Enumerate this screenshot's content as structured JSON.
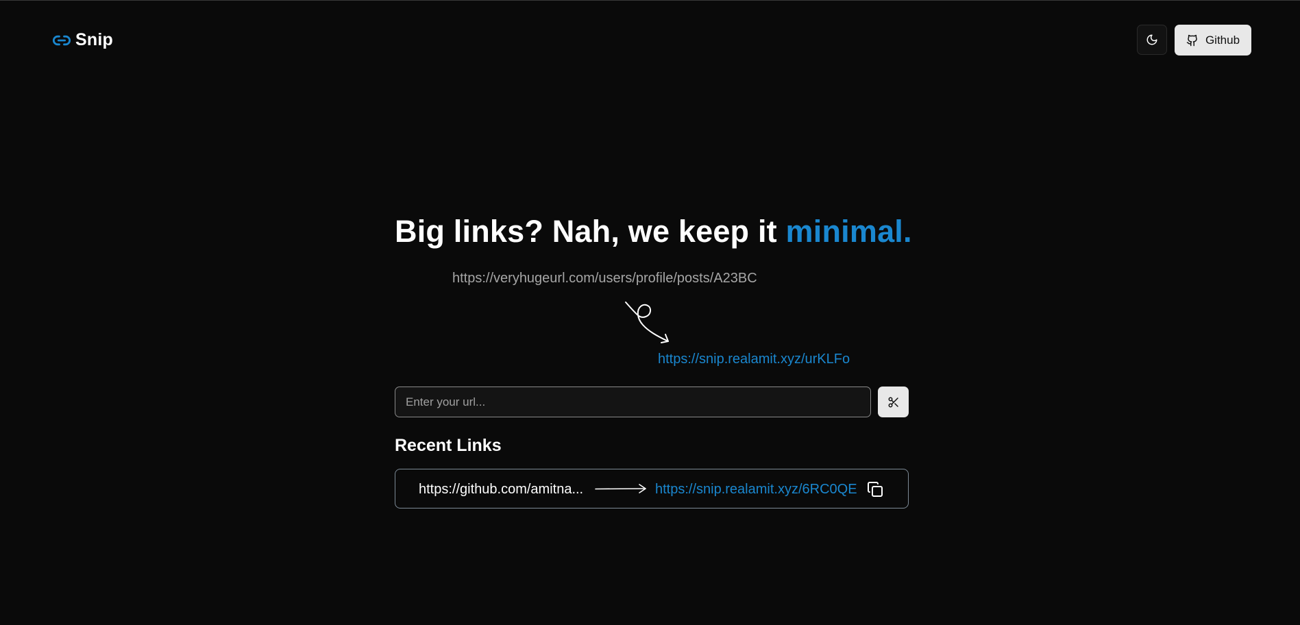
{
  "header": {
    "brand": "Snip",
    "github_label": "Github"
  },
  "hero": {
    "headline": "Big links? Nah, we keep it ",
    "headline_accent": "minimal.",
    "example_long_url": "https://veryhugeurl.com/users/profile/posts/A23BC",
    "example_short_url": "https://snip.realamit.xyz/urKLFo"
  },
  "form": {
    "placeholder": "Enter your url...",
    "value": ""
  },
  "recent": {
    "title": "Recent Links",
    "items": [
      {
        "long_url": "https://github.com/amitna...",
        "short_url": "https://snip.realamit.xyz/6RC0QE"
      }
    ]
  },
  "colors": {
    "accent": "#1a87cf",
    "background": "#0a0a0a",
    "muted_text": "#a6a6a6",
    "button_light": "#e8e8e8"
  },
  "icons": {
    "brand": "link-icon",
    "theme": "moon-icon",
    "github": "github-icon",
    "snip": "scissors-icon",
    "copy": "copy-icon"
  }
}
